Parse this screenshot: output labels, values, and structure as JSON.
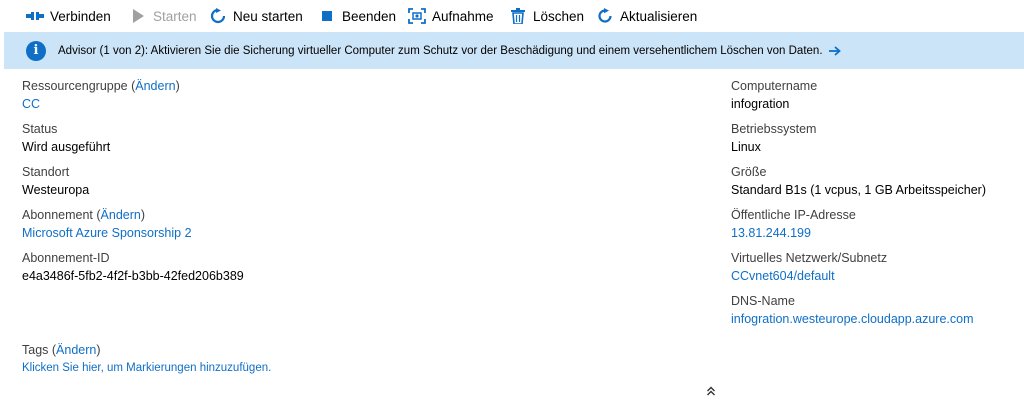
{
  "toolbar": {
    "connect": "Verbinden",
    "start": "Starten",
    "restart": "Neu starten",
    "stop": "Beenden",
    "capture": "Aufnahme",
    "delete": "Löschen",
    "refresh": "Aktualisieren"
  },
  "advisor": {
    "text": "Advisor (1 von 2): Aktivieren Sie die Sicherung virtueller Computer zum Schutz vor der Beschädigung und einem versehentlichem Löschen von Daten."
  },
  "essentials": {
    "resource_group_label": "Ressourcengruppe",
    "change": "Ändern",
    "resource_group": "CC",
    "status_label": "Status",
    "status": "Wird ausgeführt",
    "location_label": "Standort",
    "location": "Westeuropa",
    "subscription_label": "Abonnement",
    "subscription": "Microsoft Azure Sponsorship 2",
    "subscription_id_label": "Abonnement-ID",
    "subscription_id": "e4a3486f-5fb2-4f2f-b3bb-42fed206b389",
    "computer_name_label": "Computername",
    "computer_name": "infogration",
    "os_label": "Betriebssystem",
    "os": "Linux",
    "size_label": "Größe",
    "size": "Standard B1s (1 vcpus, 1 GB Arbeitsspeicher)",
    "public_ip_label": "Öffentliche IP-Adresse",
    "public_ip": "13.81.244.199",
    "vnet_label": "Virtuelles Netzwerk/Subnetz",
    "vnet": "CCvnet604/default",
    "dns_label": "DNS-Name",
    "dns": "infogration.westeurope.cloudapp.azure.com"
  },
  "tags": {
    "label": "Tags",
    "change": "Ändern",
    "hint": "Klicken Sie hier, um Markierungen hinzuzufügen."
  },
  "colors": {
    "accent": "#0f6fc6",
    "banner_bg": "#cce4f7"
  }
}
